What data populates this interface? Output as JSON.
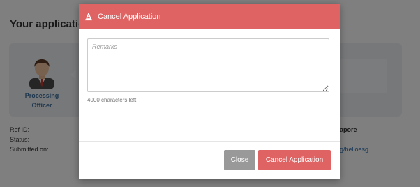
{
  "background": {
    "section_title": "Your application",
    "officer_label": "Processing Officer",
    "meta": {
      "ref_id_label": "Ref ID:",
      "status_label": "Status:",
      "submitted_label": "Submitted on:"
    },
    "country_fragment": "apore",
    "social_fragment": "g/helloesg"
  },
  "modal": {
    "title": "Cancel Application",
    "title_icon": "cone-icon",
    "remarks_placeholder": "Remarks",
    "remarks_value": "",
    "chars_left": "4000 characters left.",
    "close_label": "Close",
    "cancel_label": "Cancel Application"
  },
  "colors": {
    "header": "#e06363",
    "close_button": "#999999",
    "cancel_button": "#e06363",
    "panel": "#ecf0f5",
    "link": "#2f6fb0"
  }
}
